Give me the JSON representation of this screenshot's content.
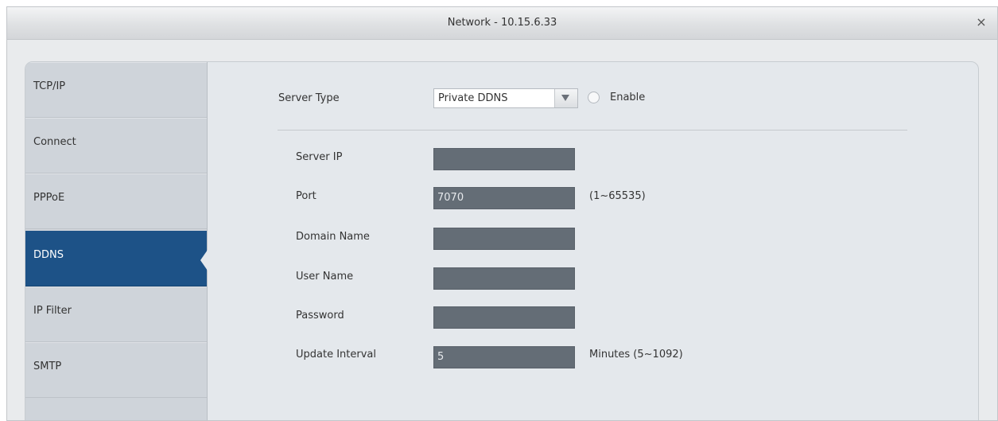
{
  "window": {
    "title": "Network - 10.15.6.33",
    "close_label": "×"
  },
  "sidebar": {
    "items": [
      {
        "label": "TCP/IP",
        "active": false
      },
      {
        "label": "Connect",
        "active": false
      },
      {
        "label": "PPPoE",
        "active": false
      },
      {
        "label": "DDNS",
        "active": true
      },
      {
        "label": "IP Filter",
        "active": false
      },
      {
        "label": "SMTP",
        "active": false
      }
    ]
  },
  "form": {
    "server_type": {
      "label": "Server Type",
      "value": "Private DDNS",
      "enable_label": "Enable",
      "enable_checked": false
    },
    "server_ip": {
      "label": "Server IP",
      "value": ""
    },
    "port": {
      "label": "Port",
      "value": "7070",
      "hint": "(1~65535)"
    },
    "domain_name": {
      "label": "Domain Name",
      "value": ""
    },
    "user_name": {
      "label": "User Name",
      "value": ""
    },
    "password": {
      "label": "Password",
      "value": ""
    },
    "update_interval": {
      "label": "Update Interval",
      "value": "5",
      "hint": "Minutes (5~1092)"
    }
  },
  "colors": {
    "active_tab": "#1d5287",
    "field_bg": "#646d76",
    "panel_bg": "#e4e8ec",
    "sidebar_bg": "#cfd4da"
  },
  "icons": {
    "close": "close-icon",
    "dropdown": "chevron-down-icon",
    "active_notch": "pointer-notch-icon"
  }
}
